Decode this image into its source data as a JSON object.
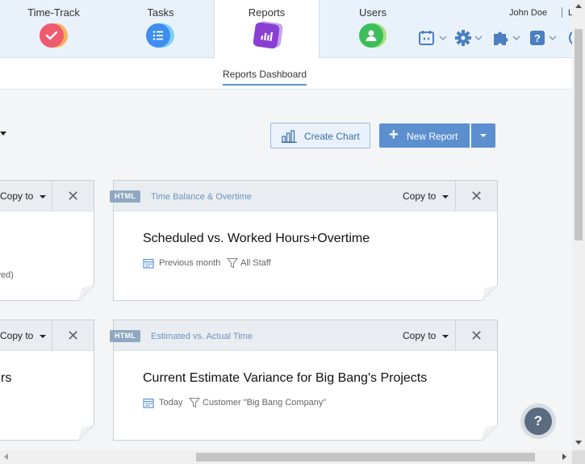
{
  "nav": {
    "tabs": [
      {
        "label": "Time-Track",
        "icon": "check-icon",
        "color": "#ef5a6f"
      },
      {
        "label": "Tasks",
        "icon": "list-icon",
        "color": "#3d8ef0"
      },
      {
        "label": "Reports",
        "icon": "bar-chart-icon",
        "color": "#8a3fd4"
      },
      {
        "label": "Users",
        "icon": "user-icon",
        "color": "#3cbe5a"
      }
    ],
    "active_tab": "Reports",
    "user_name": "John Doe",
    "logout_label": "Lo"
  },
  "subnav": {
    "tab_label": "Reports Dashboard"
  },
  "toolbar": {
    "create_chart_label": "Create Chart",
    "new_report_label": "New Report"
  },
  "cards": [
    {
      "badge": "HTML",
      "category": "Time Balance & Overtime",
      "copy_label": "Copy to",
      "title": "Scheduled vs. Worked Hours+Overtime",
      "date_filter": "Previous month",
      "staff_filter": "All Staff"
    },
    {
      "badge": "HTML",
      "category": "Estimated vs. Actual Time",
      "copy_label": "Copy to",
      "title": "Current Estimate Variance for Big Bang's Projects",
      "date_filter": "Today",
      "staff_filter": "Customer \"Big Bang Company\""
    }
  ],
  "left_cards": [
    {
      "copy_label": "Copy to",
      "snippet": "ived)"
    },
    {
      "copy_label": "Copy to",
      "snippet": "rs"
    }
  ],
  "help": {
    "label": "?"
  },
  "colors": {
    "accent": "#5b8fd0",
    "nav_bg": "#e9f1fb",
    "category_text": "#6d94be"
  }
}
